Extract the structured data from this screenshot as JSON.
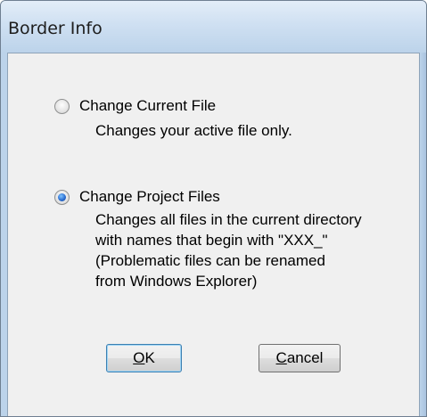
{
  "window": {
    "title": "Border Info"
  },
  "options": [
    {
      "label": "Change Current File",
      "selected": false,
      "description": [
        "Changes your active file only."
      ]
    },
    {
      "label": "Change Project Files",
      "selected": true,
      "description": [
        "Changes all files in the current directory",
        "with names that begin with \"XXX_\"",
        "(Problematic files can be renamed",
        "from Windows Explorer)"
      ]
    }
  ],
  "buttons": {
    "ok": {
      "mnemonic": "O",
      "rest": "K"
    },
    "cancel": {
      "mnemonic": "C",
      "rest": "ancel"
    }
  }
}
